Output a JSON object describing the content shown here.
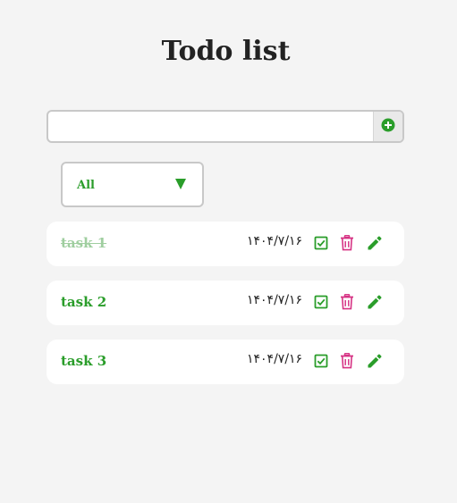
{
  "header": {
    "title": "Todo list"
  },
  "add_form": {
    "input_value": "",
    "input_placeholder": "",
    "add_icon": "plus-circle-icon"
  },
  "filter": {
    "selected": "All",
    "arrow_icon": "triangle-down-icon"
  },
  "tasks": [
    {
      "name": "task 1",
      "date": "۱۴۰۴/۷/۱۶",
      "done": true
    },
    {
      "name": "task 2",
      "date": "۱۴۰۴/۷/۱۶",
      "done": false
    },
    {
      "name": "task 3",
      "date": "۱۴۰۴/۷/۱۶",
      "done": false
    }
  ],
  "task_actions": {
    "complete_icon": "checkbox-icon",
    "delete_icon": "trash-icon",
    "edit_icon": "pencil-icon"
  },
  "colors": {
    "background": "#f4f4f4",
    "accent_green": "#2a9d2a",
    "delete_pink": "#d63384",
    "done_text": "#9fce9f"
  }
}
